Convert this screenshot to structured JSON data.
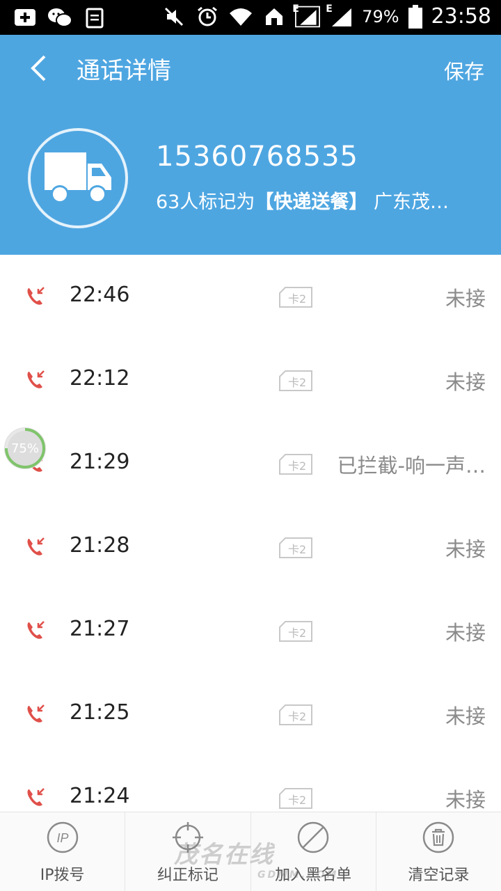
{
  "status_bar": {
    "battery_percent": "79%",
    "time": "23:58",
    "network_label": "E",
    "icons": [
      "add-notification-icon",
      "wechat-icon",
      "clipboard-icon",
      "mute-icon",
      "alarm-icon",
      "wifi-icon",
      "home-icon",
      "signal-icon",
      "signal-icon",
      "battery-icon"
    ]
  },
  "header": {
    "title": "通话详情",
    "save_label": "保存",
    "phone_number": "15360768535",
    "mark_prefix": "63人标记为",
    "mark_tag": "【快递送餐】",
    "mark_location": "广东茂…",
    "avatar_icon": "truck-icon",
    "background_color": "#4ea6e1"
  },
  "calls": [
    {
      "time": "22:46",
      "sim": "卡2",
      "status": "未接"
    },
    {
      "time": "22:12",
      "sim": "卡2",
      "status": "未接"
    },
    {
      "time": "21:29",
      "sim": "卡2",
      "status": "已拦截-响一声…"
    },
    {
      "time": "21:28",
      "sim": "卡2",
      "status": "未接"
    },
    {
      "time": "21:27",
      "sim": "卡2",
      "status": "未接"
    },
    {
      "time": "21:25",
      "sim": "卡2",
      "status": "未接"
    },
    {
      "time": "21:24",
      "sim": "卡2",
      "status": "未接"
    }
  ],
  "floating_progress": "75%",
  "bottom_bar": [
    {
      "label": "IP拨号",
      "icon": "ip-dial-icon"
    },
    {
      "label": "纠正标记",
      "icon": "crosshair-icon"
    },
    {
      "label": "加入黑名单",
      "icon": "block-icon"
    },
    {
      "label": "清空记录",
      "icon": "trash-icon"
    }
  ],
  "watermark": {
    "text": "茂名在线",
    "sub": "GDMM.COM"
  },
  "colors": {
    "missed_call": "#e0504a",
    "accent": "#4ea6e1"
  }
}
